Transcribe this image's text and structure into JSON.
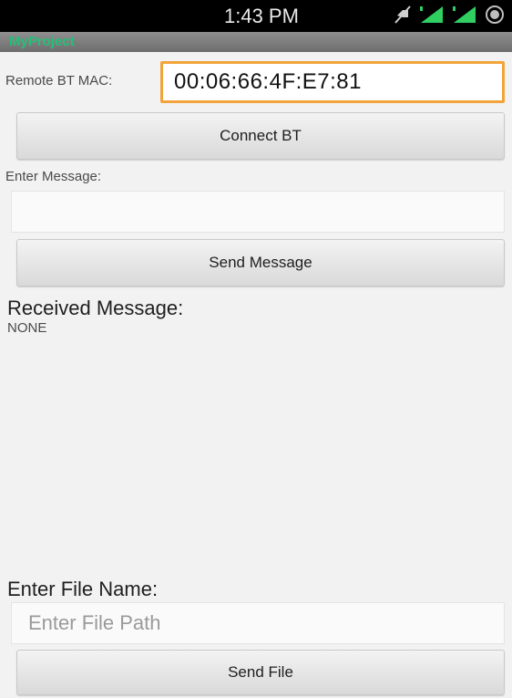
{
  "status_bar": {
    "time": "1:43 PM",
    "icons": [
      "mute-icon",
      "signal-icon",
      "signal-icon",
      "battery-icon"
    ]
  },
  "title_bar": {
    "title": "MyProject"
  },
  "mac_section": {
    "label": "Remote BT MAC:",
    "value": "00:06:66:4F:E7:81"
  },
  "connect_button": {
    "label": "Connect BT"
  },
  "message_section": {
    "label": "Enter Message:",
    "value": "",
    "send_label": "Send Message"
  },
  "received_section": {
    "heading": "Received Message:",
    "value": "NONE"
  },
  "file_section": {
    "heading": "Enter File Name:",
    "placeholder": "Enter File Path",
    "send_label": "Send File"
  },
  "colors": {
    "accent_border": "#f2a33a",
    "title_green": "#25c079",
    "status_bar_bg": "#000000",
    "screen_bg": "#f2f2f2"
  }
}
